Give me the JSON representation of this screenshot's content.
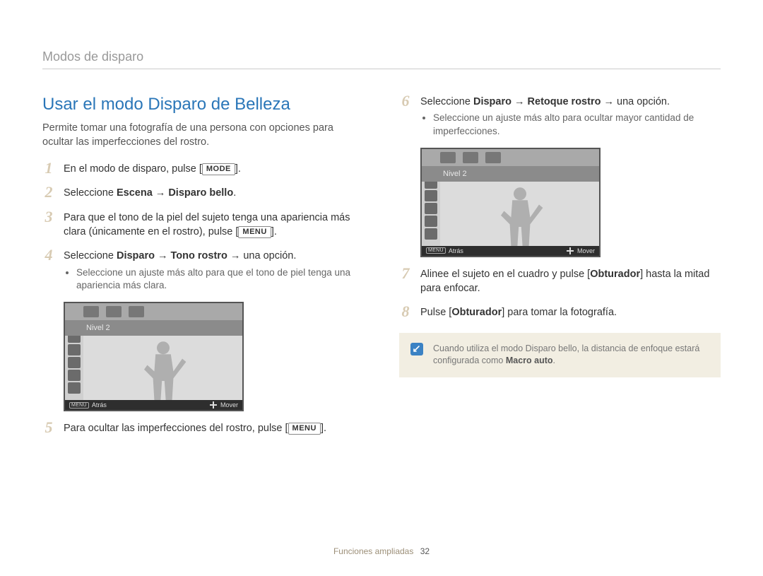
{
  "header": {
    "breadcrumb": "Modos de disparo"
  },
  "title": "Usar el modo Disparo de Belleza",
  "intro": "Permite tomar una fotografía de una persona con opciones para ocultar las imperfecciones del rostro.",
  "keys": {
    "mode": "MODE",
    "menu": "MENU"
  },
  "steps": {
    "s1": {
      "num": "1",
      "pre": "En el modo de disparo, pulse [",
      "post": "]."
    },
    "s2": {
      "num": "2",
      "pre": "Seleccione ",
      "b1": "Escena",
      "arrow": " → ",
      "b2": "Disparo bello",
      "post": "."
    },
    "s3": {
      "num": "3",
      "text_a": "Para que el tono de la piel del sujeto tenga una apariencia más clara (únicamente en el rostro), pulse [",
      "text_b": "]."
    },
    "s4": {
      "num": "4",
      "pre": "Seleccione ",
      "b1": "Disparo",
      "arrow1": " → ",
      "b2": "Tono rostro",
      "arrow2": " → una opción.",
      "bullet": "Seleccione un ajuste más alto para que el tono de piel tenga una apariencia más clara."
    },
    "s5": {
      "num": "5",
      "pre": "Para ocultar las imperfecciones del rostro, pulse [",
      "post": "]."
    },
    "s6": {
      "num": "6",
      "pre": "Seleccione ",
      "b1": "Disparo",
      "arrow1": " → ",
      "b2": "Retoque rostro",
      "arrow2": " → una opción.",
      "bullet": "Seleccione un ajuste más alto para ocultar mayor cantidad de imperfecciones."
    },
    "s7": {
      "num": "7",
      "pre": "Alinee el sujeto en el cuadro y pulse [",
      "b": "Obturador",
      "post": "] hasta la mitad para enfocar."
    },
    "s8": {
      "num": "8",
      "pre": "Pulse [",
      "b": "Obturador",
      "post": "] para tomar la fotografía."
    }
  },
  "camera_ui": {
    "level_label": "Nivel 2",
    "footer_menu": "MENU",
    "footer_back": "Atrás",
    "footer_move": "Mover"
  },
  "note": {
    "text_a": "Cuando utiliza el modo Disparo bello, la distancia de enfoque estará configurada como ",
    "bold": "Macro auto",
    "text_b": "."
  },
  "footer": {
    "section": "Funciones ampliadas",
    "page": "32"
  }
}
